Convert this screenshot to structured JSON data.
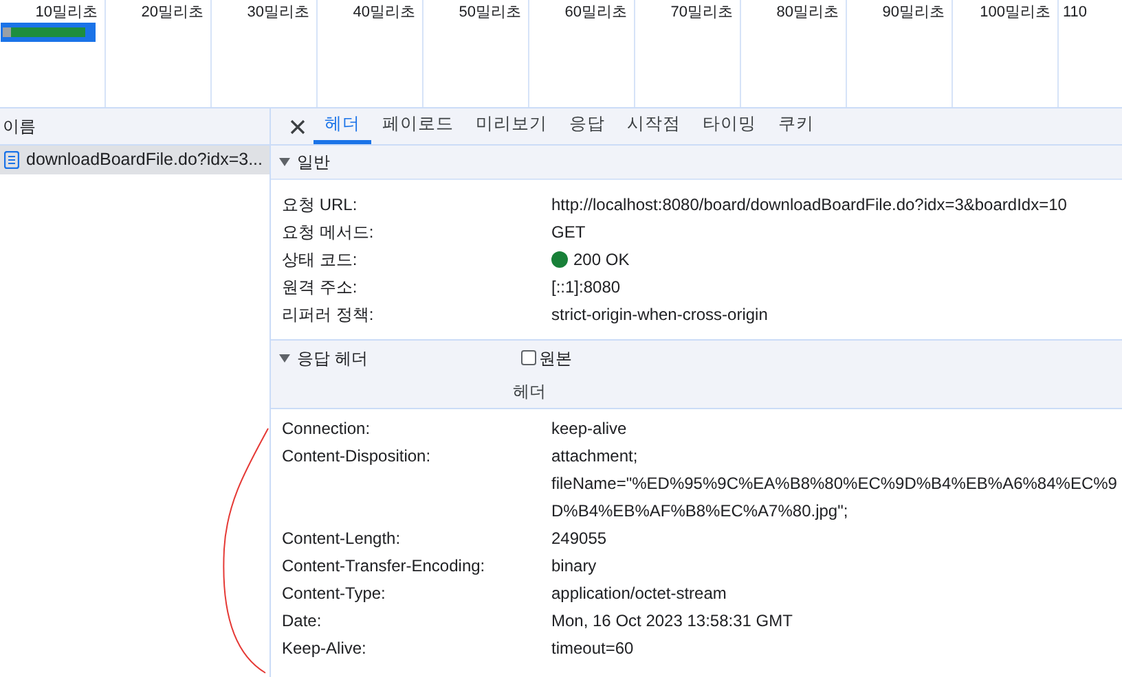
{
  "timeline": {
    "ticks": [
      "10밀리초",
      "20밀리초",
      "30밀리초",
      "40밀리초",
      "50밀리초",
      "60밀리초",
      "70밀리초",
      "80밀리초",
      "90밀리초",
      "100밀리초",
      "110"
    ]
  },
  "requests": {
    "column": "이름",
    "items": [
      {
        "name": "downloadBoardFile.do?idx=3...",
        "selected": true
      }
    ]
  },
  "tabs": [
    {
      "label": "헤더",
      "selected": true
    },
    {
      "label": "페이로드",
      "selected": false
    },
    {
      "label": "미리보기",
      "selected": false
    },
    {
      "label": "응답",
      "selected": false
    },
    {
      "label": "시작점",
      "selected": false
    },
    {
      "label": "타이밍",
      "selected": false
    },
    {
      "label": "쿠키",
      "selected": false
    }
  ],
  "general": {
    "title": "일반",
    "expanded": true,
    "rows": [
      {
        "name": "요청 URL:",
        "value": "http://localhost:8080/board/downloadBoardFile.do?idx=3&boardIdx=10"
      },
      {
        "name": "요청 메서드:",
        "value": "GET"
      },
      {
        "name": "상태 코드:",
        "value": "200 OK",
        "color": "#188038"
      },
      {
        "name": "원격 주소:",
        "value": "[::1]:8080"
      },
      {
        "name": "리퍼러 정책:",
        "value": "strict-origin-when-cross-origin"
      }
    ]
  },
  "response_headers": {
    "title": "응답 헤더",
    "expanded": true,
    "raw_checkbox": {
      "label": "원본",
      "checked": false
    },
    "subtitle": "헤더",
    "rows": [
      {
        "name": "Connection:",
        "value": [
          "keep-alive"
        ]
      },
      {
        "name": "Content-Disposition:",
        "value": [
          "attachment;",
          "fileName=\"%ED%95%9C%EA%B8%80%EC%9D%B4%EB%A6%84%EC%9",
          "D%B4%EB%AF%B8%EC%A7%80.jpg\";"
        ]
      },
      {
        "name": "Content-Length:",
        "value": [
          "249055"
        ]
      },
      {
        "name": "Content-Transfer-Encoding:",
        "value": [
          "binary"
        ]
      },
      {
        "name": "Content-Type:",
        "value": [
          "application/octet-stream"
        ]
      },
      {
        "name": "Date:",
        "value": [
          "Mon, 16 Oct 2023 13:58:31 GMT"
        ]
      },
      {
        "name": "Keep-Alive:",
        "value": [
          "timeout=60"
        ]
      }
    ]
  }
}
